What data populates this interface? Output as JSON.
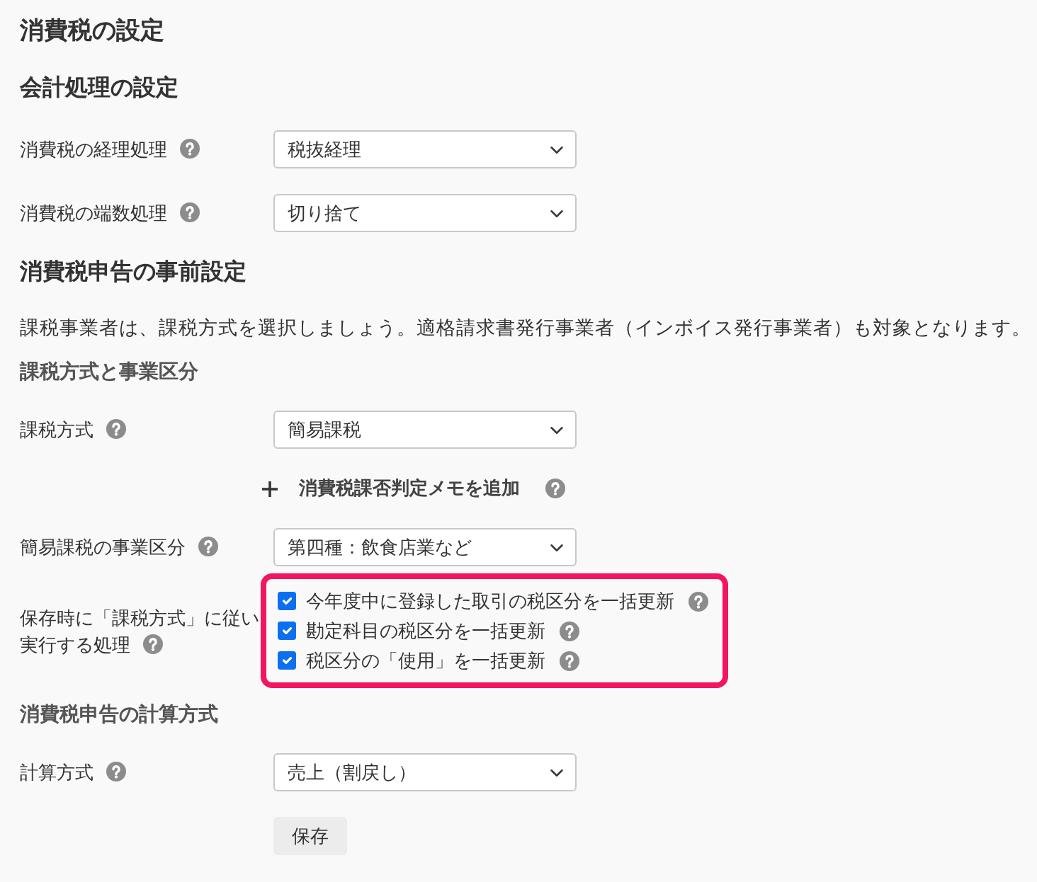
{
  "blocks": [
    {
      "kind": "title",
      "text": "消費税の設定"
    },
    {
      "kind": "section",
      "text": "会計処理の設定"
    },
    {
      "kind": "select",
      "label": "消費税の経理処理",
      "value": "税抜経理"
    },
    {
      "kind": "select",
      "label": "消費税の端数処理",
      "value": "切り捨て"
    },
    {
      "kind": "section",
      "text": "消費税申告の事前設定"
    },
    {
      "kind": "paragraph",
      "text": "課税事業者は、課税方式を選択しましょう。適格請求書発行事業者（インボイス発行事業者）も対象となります。"
    },
    {
      "kind": "subsection",
      "text": "課税方式と事業区分"
    },
    {
      "kind": "select",
      "label": "課税方式",
      "value": "簡易課税"
    },
    {
      "kind": "link",
      "text": "消費税課否判定メモを追加"
    },
    {
      "kind": "select",
      "label": "簡易課税の事業区分",
      "value": "第四種：飲食店業など"
    },
    {
      "kind": "checks",
      "label_lines": [
        "保存時に「課税方式」に従い",
        "実行する処理"
      ],
      "highlighted": true,
      "options": [
        {
          "text": "今年度中に登録した取引の税区分を一括更新",
          "checked": true
        },
        {
          "text": "勘定科目の税区分を一括更新",
          "checked": true
        },
        {
          "text": "税区分の「使用」を一括更新",
          "checked": true
        }
      ]
    },
    {
      "kind": "subsection",
      "text": "消費税申告の計算方式"
    },
    {
      "kind": "select",
      "label": "計算方式",
      "value": "売上（割戻し）"
    },
    {
      "kind": "button",
      "text": "保存"
    }
  ]
}
